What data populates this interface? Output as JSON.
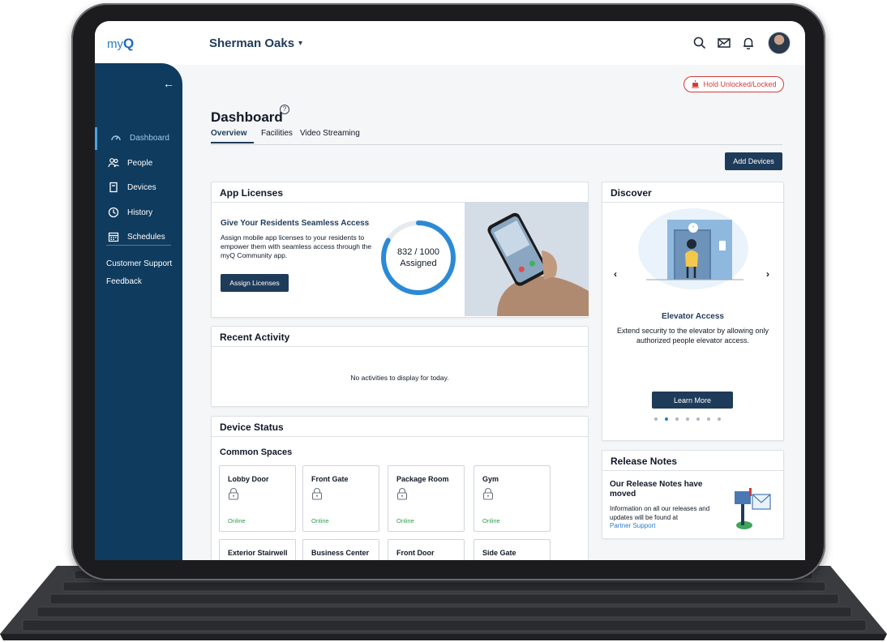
{
  "topbar": {
    "logo_prefix": "my",
    "logo_suffix": "Q",
    "site_name": "Sherman Oaks",
    "site_caret": "▾",
    "icons": [
      "search-icon",
      "mail-icon",
      "bell-icon",
      "avatar"
    ]
  },
  "sidebar": {
    "back": "←",
    "items": [
      {
        "label": "Dashboard",
        "icon": "speedometer-icon",
        "active": true
      },
      {
        "label": "People",
        "icon": "people-icon",
        "active": false
      },
      {
        "label": "Devices",
        "icon": "device-icon",
        "active": false
      },
      {
        "label": "History",
        "icon": "clock-icon",
        "active": false
      },
      {
        "label": "Schedules",
        "icon": "calendar-icon",
        "active": false
      }
    ],
    "links": [
      "Customer Support",
      "Feedback"
    ]
  },
  "header": {
    "hold_button": "Hold Unlocked/Locked",
    "title": "Dashboard",
    "help": "?",
    "tabs": [
      "Overview",
      "Facilities",
      "Video Streaming"
    ],
    "add_devices": "Add Devices"
  },
  "app_licenses": {
    "heading": "App Licenses",
    "title": "Give Your Residents Seamless Access",
    "text": "Assign mobile app licenses to your residents to empower them with seamless access through the myQ Community app.",
    "button": "Assign Licenses",
    "assigned_count": "832 / 1000",
    "assigned_label": "Assigned",
    "assigned_fraction": 0.832
  },
  "recent_activity": {
    "heading": "Recent Activity",
    "empty": "No activities to display for today."
  },
  "device_status": {
    "heading": "Device Status",
    "section": "Common Spaces",
    "devices": [
      {
        "name": "Lobby Door",
        "status": "Online"
      },
      {
        "name": "Front Gate",
        "status": "Online"
      },
      {
        "name": "Package Room",
        "status": "Online"
      },
      {
        "name": "Gym",
        "status": "Online"
      }
    ],
    "devices_row2": [
      {
        "name": "Exterior Stairwell"
      },
      {
        "name": "Business Center"
      },
      {
        "name": "Front Door"
      },
      {
        "name": "Side Gate"
      }
    ]
  },
  "discover": {
    "heading": "Discover",
    "prev": "‹",
    "next": "›",
    "title": "Elevator Access",
    "text": "Extend security to the elevator by allowing only authorized people elevator access.",
    "button": "Learn More",
    "slide_count": 7,
    "active_slide": 2
  },
  "release_notes": {
    "heading": "Release Notes",
    "title": "Our Release Notes have moved",
    "text": "Information on all our releases and updates will be found at",
    "link": "Partner Support"
  },
  "colors": {
    "navy": "#0f3b5e",
    "button": "#1f3b5a",
    "accent": "#2b7cc7",
    "online": "#2e9c4c",
    "alert": "#d33b3b"
  }
}
